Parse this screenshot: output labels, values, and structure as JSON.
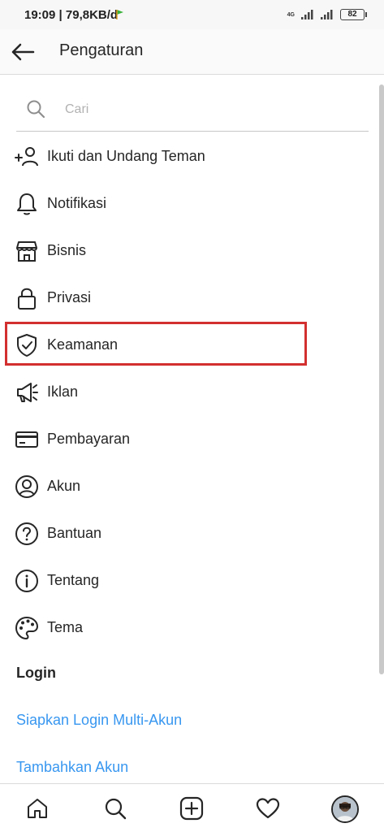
{
  "status_bar": {
    "time_speed": "19:09 | 79,8KB/d",
    "network": "4G",
    "battery": "82"
  },
  "header": {
    "title": "Pengaturan"
  },
  "search": {
    "placeholder": "Cari"
  },
  "menu": {
    "items": [
      {
        "label": "Ikuti dan Undang Teman",
        "icon": "add-person-icon"
      },
      {
        "label": "Notifikasi",
        "icon": "bell-icon"
      },
      {
        "label": "Bisnis",
        "icon": "shop-icon"
      },
      {
        "label": "Privasi",
        "icon": "lock-icon"
      },
      {
        "label": "Keamanan",
        "icon": "shield-check-icon"
      },
      {
        "label": "Iklan",
        "icon": "megaphone-icon"
      },
      {
        "label": "Pembayaran",
        "icon": "credit-card-icon"
      },
      {
        "label": "Akun",
        "icon": "account-circle-icon"
      },
      {
        "label": "Bantuan",
        "icon": "help-icon"
      },
      {
        "label": "Tentang",
        "icon": "info-icon"
      },
      {
        "label": "Tema",
        "icon": "palette-icon"
      }
    ]
  },
  "login_section": {
    "title": "Login",
    "links": [
      "Siapkan Login Multi-Akun",
      "Tambahkan Akun"
    ]
  },
  "bottom_nav": {
    "items": [
      "home-icon",
      "search-icon",
      "create-post-icon",
      "activity-heart-icon",
      "profile-avatar"
    ]
  },
  "colors": {
    "link": "#3897f0",
    "highlight_border": "#d32f2f",
    "text": "#262626"
  }
}
